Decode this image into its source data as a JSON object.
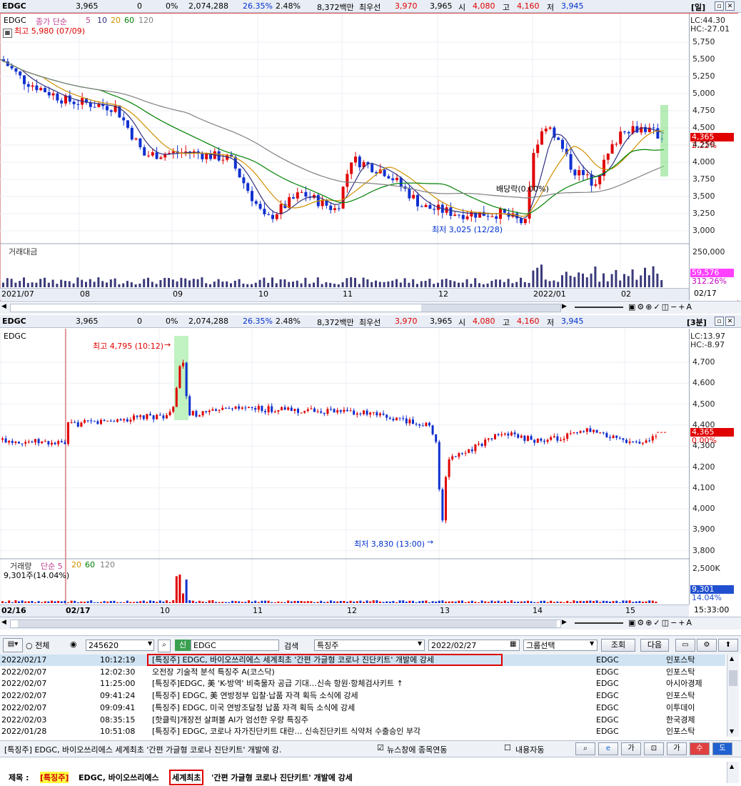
{
  "quote_bar": {
    "code": "EDGC",
    "price": "3,965",
    "change": "0",
    "change_pct": "0%",
    "volume": "2,074,288",
    "ratio": "26.35%",
    "turnover_pct": "2.48%",
    "amount": "8,372백만",
    "ask_label": "최우선",
    "ask": "3,970",
    "bid": "3,965",
    "open_label": "시",
    "open": "4,080",
    "high_label": "고",
    "high": "4,160",
    "low_label": "저",
    "low": "3,945"
  },
  "daily_chart": {
    "period_badge": "[일]",
    "name": "EDGC",
    "ma_label": "종가 단순",
    "ma_periods": [
      "5",
      "10",
      "20",
      "60",
      "120"
    ],
    "lc": "LC:44.30",
    "hc": "HC:-27.01",
    "high_note": "최고 5,980 (07/09)",
    "low_note": "최저 3,025 (12/28)",
    "dividend_note": "배당락(0.00%)",
    "y_ticks": [
      "5,750",
      "5,500",
      "5,250",
      "5,000",
      "4,750",
      "4,500",
      "4,250",
      "4,000",
      "3,750",
      "3,500",
      "3,250",
      "3,000"
    ],
    "price_tag": "4,365",
    "price_pct": "2.22%",
    "volume_title": "거래대금",
    "volume_ticks": [
      "250,000"
    ],
    "volume_tag": "59,576",
    "volume_pct": "312.26%",
    "x_labels": [
      "2021/07",
      "08",
      "09",
      "10",
      "11",
      "12",
      "2022/01",
      "02"
    ],
    "x_end": "02/17"
  },
  "minute_chart": {
    "period_badge": "[3분]",
    "name": "EDGC",
    "lc": "LC:13.97",
    "hc": "HC:-8.97",
    "high_note": "최고 4,795 (10:12)",
    "low_note": "최저 3,830 (13:00)",
    "y_ticks": [
      "4,700",
      "4,600",
      "4,500",
      "4,400",
      "4,300",
      "4,200",
      "4,100",
      "4,000",
      "3,900",
      "3,800"
    ],
    "price_tag": "4,365",
    "price_pct": "0.00%",
    "volume_title": "거래량",
    "volume_ma_label": "단순 5",
    "volume_ma_periods": [
      "20",
      "60",
      "120"
    ],
    "volume_note": "9,301주(14.04%)",
    "volume_ticks": [
      "2,500K"
    ],
    "volume_tag": "9,301",
    "volume_pct": "14.04%",
    "x_labels": [
      "02/16",
      "02/17",
      "10",
      "11",
      "12",
      "13",
      "14",
      "15"
    ],
    "x_end": "15:33:00"
  },
  "news_toolbar": {
    "radio_all": "전체",
    "code": "245620",
    "market_badge": "신",
    "name": "EDGC",
    "search_label": "검색",
    "keyword": "특징주",
    "date": "2022/02/27",
    "group": "그룹선택",
    "query_button": "조회",
    "next_button": "다음"
  },
  "news_rows": [
    {
      "date": "2022/02/17",
      "time": "10:12:19",
      "title": "[특징주] EDGC, 바이오쓰리에스 세계최초 '간편 가글형 코로나 진단키트' 개발에 강세",
      "code": "EDGC",
      "source": "인포스탁"
    },
    {
      "date": "2022/02/07",
      "time": "12:02:30",
      "title": "오전장 기술적 분석 특징주 A(코스닥)",
      "code": "EDGC",
      "source": "인포스탁"
    },
    {
      "date": "2022/02/07",
      "time": "11:25:00",
      "title": "[특징주]EDGC, 美 'K-방역' 비축물자 공급 기대…신속 항원·항체검사키트 ↑",
      "code": "EDGC",
      "source": "아시아경제"
    },
    {
      "date": "2022/02/07",
      "time": "09:41:24",
      "title": "[특징주] EDGC, 美 연방정부 입찰·납품 자격 획득 소식에 강세",
      "code": "EDGC",
      "source": "인포스탁"
    },
    {
      "date": "2022/02/07",
      "time": "09:09:41",
      "title": "[특징주] EDGC, 미국 연방조달청 납품 자격 획득 소식에 강세",
      "code": "EDGC",
      "source": "이투데이"
    },
    {
      "date": "2022/02/03",
      "time": "08:35:15",
      "title": "[핫클릭]개장전 살펴볼 AI가 엄선한 우량 특징주",
      "code": "EDGC",
      "source": "한국경제"
    },
    {
      "date": "2022/01/28",
      "time": "10:51:08",
      "title": "[특징주] EDGC, 코로나 자가진단키트 대란… 신속진단키트 식약처 수출승인 부각",
      "code": "EDGC",
      "source": "인포스탁"
    }
  ],
  "ticker_bar": {
    "headline": "[특징주] EDGC, 바이오쓰리에스 세계최초 '간편 가글형 코로나 진단키트' 개발에 강.",
    "news_link_label": "뉴스창에 종목연동",
    "content_auto_label": "내용자동",
    "font_up": "가",
    "font_down": "가",
    "sell": "수",
    "buy": "도"
  },
  "article": {
    "title_label": "제목 :",
    "tag": "[특징주]",
    "prefix": "EDGC, 바이오쓰리에스",
    "highlight": "세계최초",
    "suffix": "'간편 가글형 코로나 진단키트' 개발에 강세"
  }
}
